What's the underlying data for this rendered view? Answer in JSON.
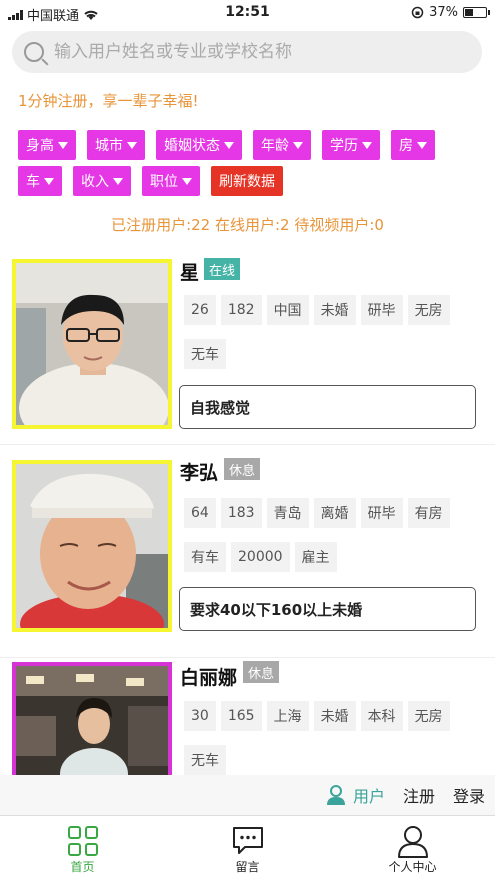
{
  "status": {
    "carrier": "中国联通",
    "time": "12:51",
    "battery": "37%"
  },
  "search": {
    "placeholder": "输入用户姓名或专业或学校名称"
  },
  "promo": "1分钟注册，享一辈子幸福!",
  "filters": [
    "身高",
    "城市",
    "婚姻状态",
    "年龄",
    "学历",
    "房",
    "车",
    "收入",
    "职位"
  ],
  "refresh_label": "刷新数据",
  "stats": "已注册用户:22    在线用户:2    待视频用户:0",
  "users": [
    {
      "name": "星",
      "status": "在线",
      "tags": [
        "26",
        "182",
        "中国",
        "未婚",
        "研毕",
        "无房",
        "无车"
      ],
      "motto": "自我感觉"
    },
    {
      "name": "李弘",
      "status": "休息",
      "tags": [
        "64",
        "183",
        "青岛",
        "离婚",
        "研毕",
        "有房",
        "有车",
        "20000",
        "雇主"
      ],
      "motto": "要求40以下160以上未婚"
    },
    {
      "name": "白丽娜",
      "status": "休息",
      "tags": [
        "30",
        "165",
        "上海",
        "未婚",
        "本科",
        "无房",
        "无车"
      ]
    }
  ],
  "auth": {
    "user": "用户",
    "register": "注册",
    "login": "登录"
  },
  "tabs": [
    {
      "label": "首页",
      "icon": "grid-icon"
    },
    {
      "label": "留言",
      "icon": "chat-bubble-icon"
    },
    {
      "label": "个人中心",
      "icon": "person-icon"
    }
  ],
  "colors": {
    "accent": "#e637e6",
    "refresh": "#e53325",
    "online": "#45b3a6",
    "promo": "#e8953a",
    "tab_active": "#3aa842"
  }
}
